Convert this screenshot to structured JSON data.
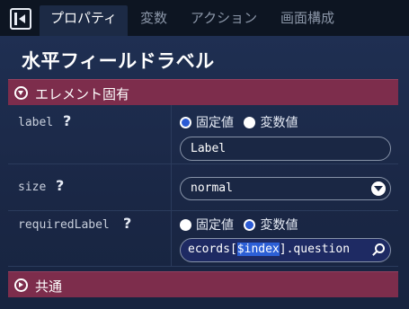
{
  "tabs": [
    {
      "label": "プロパティ"
    },
    {
      "label": "変数"
    },
    {
      "label": "アクション"
    },
    {
      "label": "画面構成"
    }
  ],
  "panel": {
    "title": "水平フィールドラベル",
    "section_element": "エレメント固有",
    "section_common": "共通"
  },
  "props": {
    "label": {
      "name": "label",
      "help": "?",
      "radio_fixed": "固定値",
      "radio_var": "変数値",
      "selected": "fixed",
      "value": "Label"
    },
    "size": {
      "name": "size",
      "help": "?",
      "value": "normal"
    },
    "requiredLabel": {
      "name": "requiredLabel",
      "help": "?",
      "radio_fixed": "固定値",
      "radio_var": "変数値",
      "selected": "variable",
      "expr_before": "ecords[",
      "expr_highlight": "$index",
      "expr_after": "].question"
    }
  },
  "colors": {
    "background": "#1c2a45",
    "tabbar": "#0d1522",
    "section_header": "#7d2d4c",
    "radio_selected": "#2a5ad4",
    "highlight": "#2c5fd6"
  }
}
